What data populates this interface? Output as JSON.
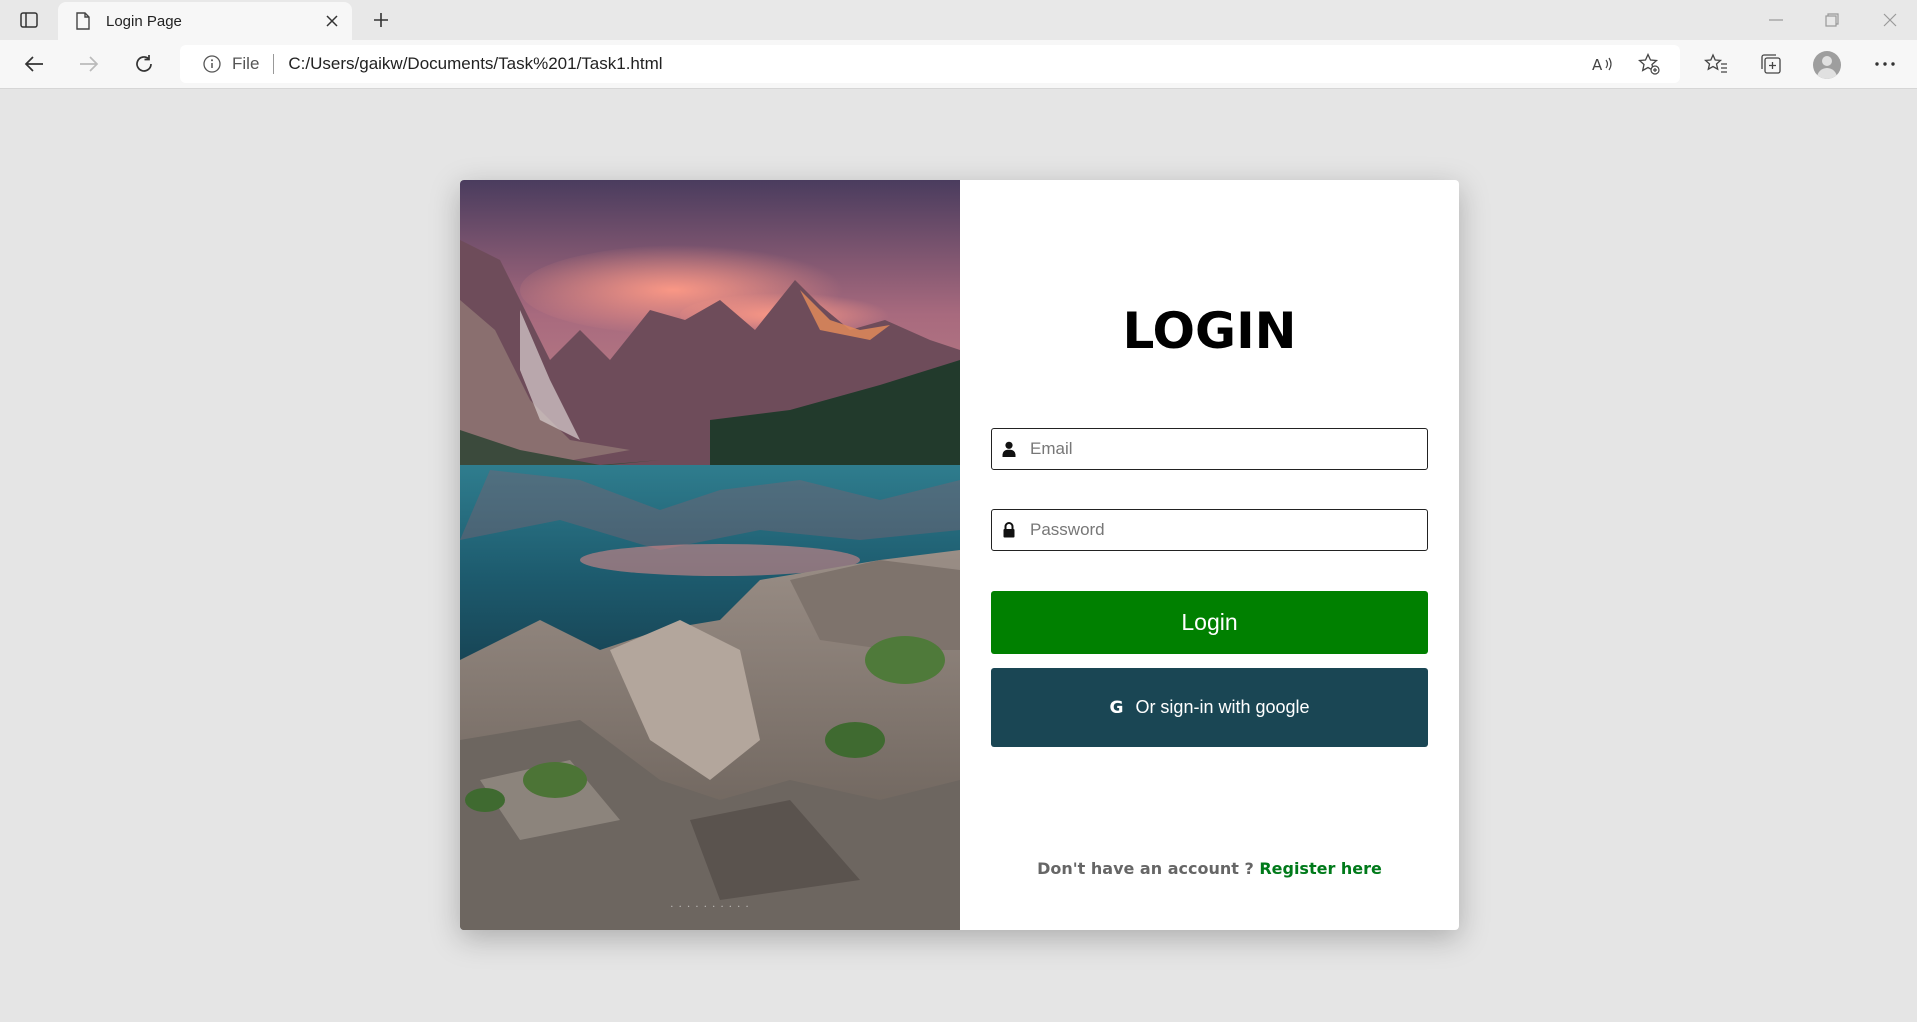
{
  "browser": {
    "tab_title": "Login Page",
    "address_scheme": "File",
    "address_url": "C:/Users/gaikw/Documents/Task%201/Task1.html"
  },
  "login": {
    "title": "LOGIN",
    "email_placeholder": "Email",
    "password_placeholder": "Password",
    "login_button": "Login",
    "google_icon_letter": "G",
    "google_button": "Or sign-in with google",
    "register_prompt": "Don't have an account ?",
    "register_link": "Register here"
  },
  "colors": {
    "page_background": "#e5e5e5",
    "login_button": "#008000",
    "google_button": "#1a4654",
    "register_link": "#007a1a"
  },
  "icons": [
    "sidebar-toggle-icon",
    "page-icon",
    "close-icon",
    "plus-icon",
    "minimize-icon",
    "restore-icon",
    "back-arrow-icon",
    "forward-arrow-icon",
    "refresh-icon",
    "info-icon",
    "read-aloud-icon",
    "add-favorite-icon",
    "favorites-icon",
    "collections-icon",
    "profile-avatar",
    "more-icon",
    "user-icon",
    "lock-icon",
    "google-icon"
  ]
}
